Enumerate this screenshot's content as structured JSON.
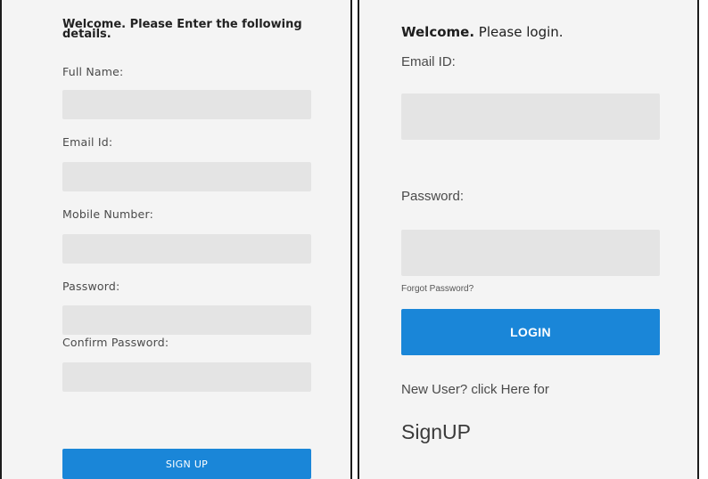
{
  "signup": {
    "heading": "Welcome. Please Enter the following details.",
    "fields": [
      {
        "label": "Full Name:",
        "value": ""
      },
      {
        "label": "Email Id:",
        "value": ""
      },
      {
        "label": "Mobile Number:",
        "value": ""
      },
      {
        "label": "Password:",
        "value": ""
      },
      {
        "label": "Confirm Password:",
        "value": ""
      }
    ],
    "button_label": "SIGN UP"
  },
  "login": {
    "heading_bold": "Welcome.",
    "heading_rest": " Please login.",
    "email_label": "Email ID:",
    "email_value": "",
    "password_label": "Password:",
    "password_value": "",
    "forgot_label": "Forgot Password?",
    "button_label": "LOGIN",
    "new_user_text": "New User? click Here for",
    "signup_link": "SignUP"
  },
  "colors": {
    "accent": "#1a86d8",
    "panel_bg": "#f4f4f4",
    "input_bg": "#e4e4e4"
  }
}
